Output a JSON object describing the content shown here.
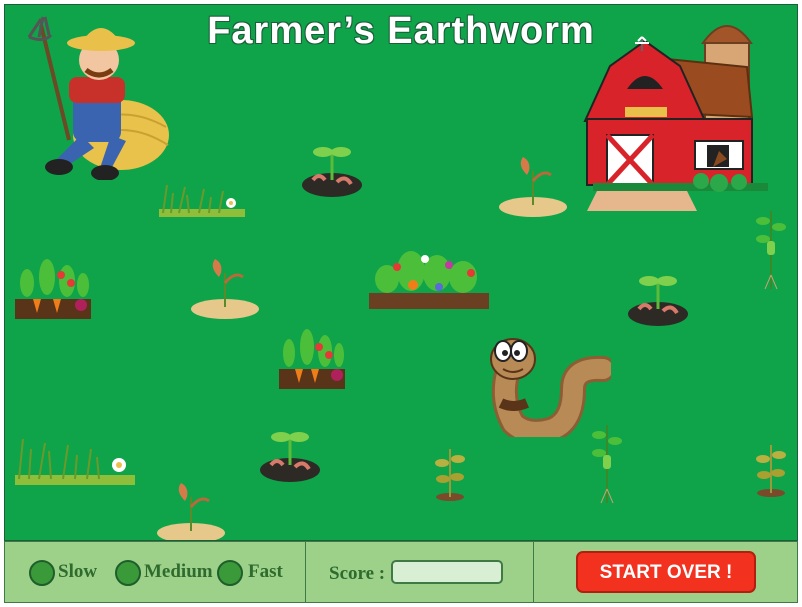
{
  "title": "Farmer’s Earthworm",
  "sprites": [
    {
      "name": "farmer-on-haystack",
      "kind": "farmer"
    },
    {
      "name": "red-barn-with-silo",
      "kind": "barn"
    },
    {
      "name": "sprout-mound",
      "kind": "sprout"
    },
    {
      "name": "grass-tuft",
      "kind": "grass"
    },
    {
      "name": "dry-soil-seedling",
      "kind": "dry"
    },
    {
      "name": "vegetable-bed",
      "kind": "vegbed"
    },
    {
      "name": "flower-garden-bed",
      "kind": "flowerbed"
    },
    {
      "name": "earthworm-player",
      "kind": "worm"
    },
    {
      "name": "wilted-plant",
      "kind": "wilted"
    },
    {
      "name": "healthy-plant",
      "kind": "plant"
    }
  ],
  "controls": {
    "speed_options": [
      "Slow",
      "Medium",
      "Fast"
    ],
    "score_label": "Score :",
    "score_value": "",
    "start_over_label": "START OVER !"
  },
  "colors": {
    "field": "#0fa34a",
    "panel": "#9dd18a",
    "start_button": "#f2311e"
  }
}
